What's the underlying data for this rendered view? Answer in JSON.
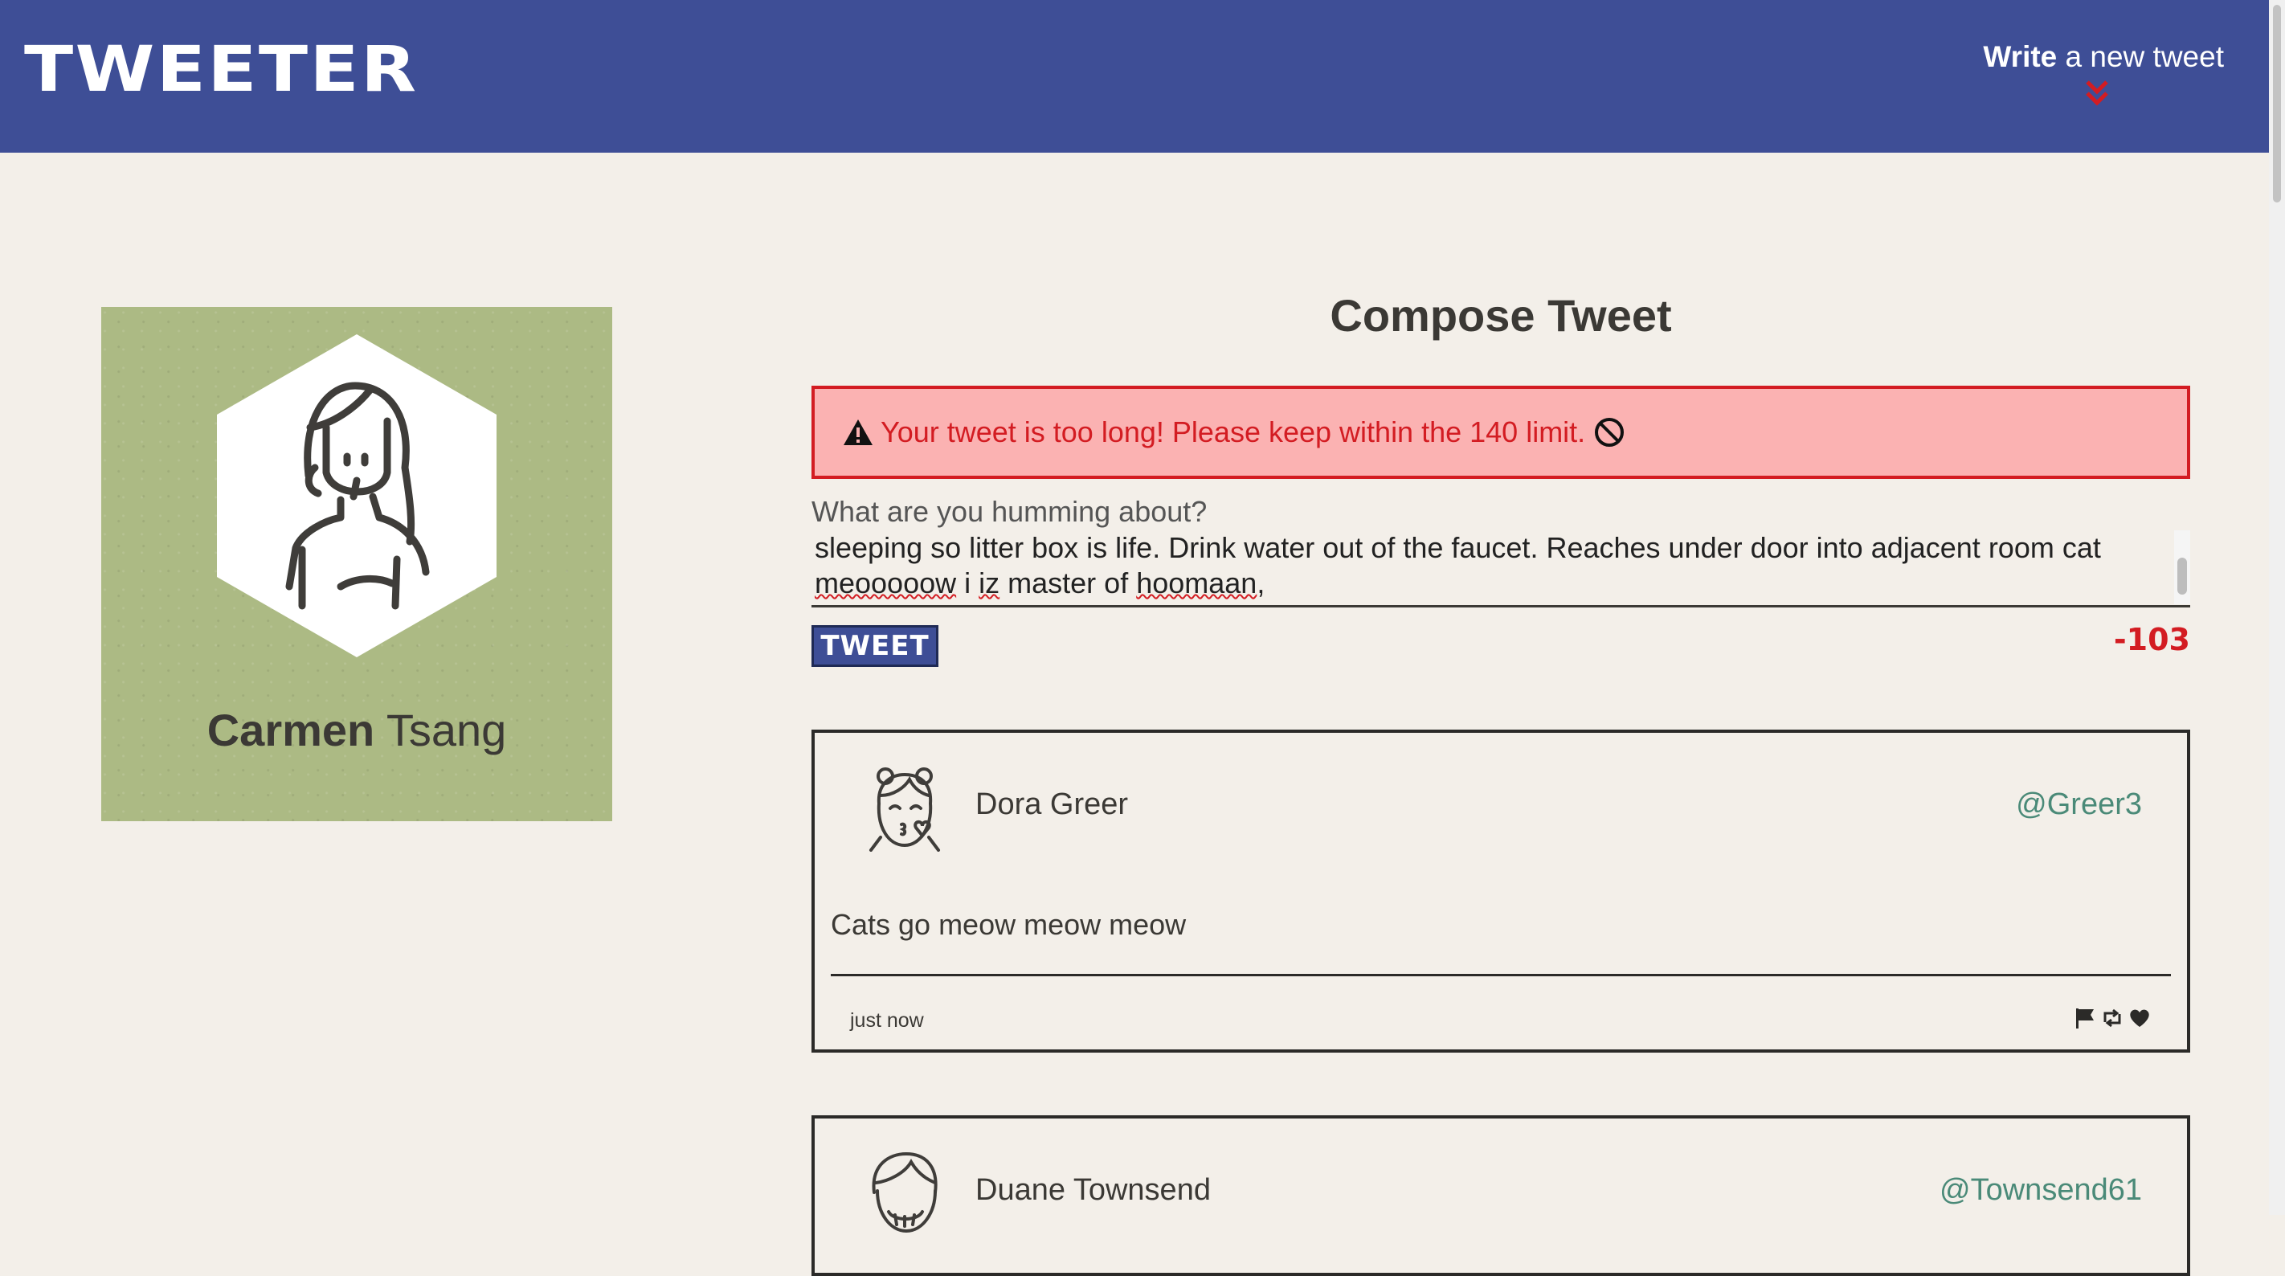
{
  "nav": {
    "logo": "TWEETER",
    "write_bold": "Write",
    "write_rest": " a new tweet"
  },
  "profile": {
    "first_name": "Carmen",
    "last_name": " Tsang"
  },
  "compose": {
    "title": "Compose Tweet",
    "error": "Your tweet is too long! Please keep within the 140 limit.",
    "prompt": "What are you humming about?",
    "text_line1": "sleeping so litter box is life. Drink water out of the faucet. Reaches under door into adjacent room cat",
    "text_line2_a": "meooooow",
    "text_line2_b": " i ",
    "text_line2_c": "iz",
    "text_line2_d": " master of ",
    "text_line2_e": "hoomaan",
    "text_line2_f": ",",
    "button": "TWEET",
    "counter": "-103"
  },
  "tweets": [
    {
      "name": "Dora Greer",
      "handle": "@Greer3",
      "body": "Cats go meow meow meow",
      "time": "just now"
    },
    {
      "name": "Duane Townsend",
      "handle": "@Townsend61"
    }
  ],
  "colors": {
    "nav": "#3e4e96",
    "error_bg": "#fbb2b2",
    "error_text": "#d31c22",
    "handle": "#4a8a78",
    "profile_bg": "#acba84"
  }
}
